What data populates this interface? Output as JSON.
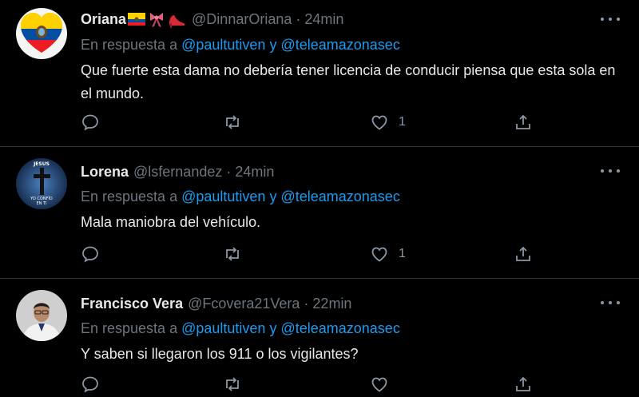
{
  "reply_prefix": "En respuesta a",
  "reply_to": [
    "@paultutiven",
    "y",
    "@teleamazonasec"
  ],
  "tweets": [
    {
      "name": "Oriana",
      "handle": "@DinnarOriana",
      "dot": "·",
      "time": "24min",
      "text": "Que fuerte esta dama no debería tener licencia de conducir piensa que esta sola en el mundo.",
      "likes": "1",
      "name_emoji_icons": [
        "ecuador-flag-icon",
        "ribbon-icon",
        "high-heel-icon"
      ]
    },
    {
      "name": "Lorena",
      "handle": "@lsfernandez",
      "dot": "·",
      "time": "24min",
      "text": "Mala maniobra del vehículo.",
      "likes": "1"
    },
    {
      "name": "Francisco Vera",
      "handle": "@Fcovera21Vera",
      "dot": "·",
      "time": "22min",
      "text": "Y saben si llegaron los 911 o los vigilantes?",
      "likes": ""
    }
  ],
  "avatar_text": "JESUS YO CONFÍO EN TI",
  "colors": {
    "background": "#000000",
    "accent": "#1d9bf0",
    "muted": "#6e767d",
    "text": "#e7e9ea",
    "divider": "#2f3336"
  },
  "icons": [
    "reply-icon",
    "retweet-icon",
    "like-icon",
    "share-icon",
    "more-icon"
  ]
}
